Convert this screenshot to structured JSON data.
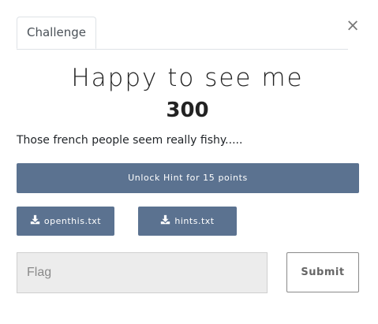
{
  "modal": {
    "close_label": "×",
    "tabs": [
      {
        "label": "Challenge",
        "active": true
      }
    ]
  },
  "challenge": {
    "name": "Happy to see me",
    "value": "300",
    "description": "Those french people seem really fishy....."
  },
  "hint": {
    "label": "Unlock Hint for 15 points"
  },
  "files": [
    {
      "label": "openthis.txt",
      "icon": "download-icon"
    },
    {
      "label": "hints.txt",
      "icon": "download-icon"
    }
  ],
  "submission": {
    "placeholder": "Flag",
    "value": "",
    "submit_label": "Submit"
  },
  "colors": {
    "button_bg": "#5b7290",
    "input_bg": "#ececec"
  }
}
